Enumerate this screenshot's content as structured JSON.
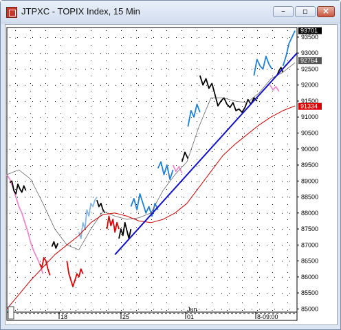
{
  "window": {
    "title": "JTPXC - TOPIX Index, 15 Min",
    "icon": "app-icon",
    "controls": [
      "minimize-icon",
      "maximize-icon",
      "close-icon"
    ]
  },
  "chart_data": {
    "type": "line",
    "title": "JTPXC - TOPIX Index, 15 Min",
    "ylim": [
      84900,
      93800
    ],
    "y_ticks": [
      85000,
      85500,
      86000,
      86500,
      87000,
      87500,
      88000,
      88500,
      89000,
      89500,
      90000,
      90500,
      91000,
      91500,
      92000,
      92500,
      93000,
      93500
    ],
    "y_tick_labels": [
      "85000",
      "85500",
      "86000",
      "86500",
      "87000",
      "87500",
      "88000",
      "88500",
      "89000",
      "89500",
      "90000",
      "90500",
      "91000",
      "91500",
      "92000",
      "92500",
      "93000",
      "93500"
    ],
    "x_tick_labels": [
      "18",
      "25",
      "01",
      "8-09:00"
    ],
    "x_upper_label": "Jun",
    "grid": true,
    "price_tags": [
      {
        "label": "93701",
        "value": 93701,
        "bg": "#000000",
        "fg": "#ffffff"
      },
      {
        "label": "92764",
        "value": 92764,
        "bg": "#555555",
        "fg": "#ffffff"
      },
      {
        "label": "91334",
        "value": 91334,
        "bg": "#dd0000",
        "fg": "#ffffff"
      }
    ],
    "colors": {
      "price_black": "#000000",
      "price_blue": "#1e7fd6",
      "price_lightblue": "#8ab6e0",
      "price_red": "#dd0000",
      "price_pink": "#ee88cc",
      "ma_short": "#666666",
      "ma_long": "#cc0000",
      "trendline": "#1010cc"
    },
    "series": [
      {
        "color_key": "price_pink",
        "points": [
          [
            0,
            89200
          ],
          [
            3,
            89050
          ],
          [
            6,
            88800
          ],
          [
            9,
            88500
          ],
          [
            12,
            88200
          ],
          [
            15,
            88000
          ],
          [
            18,
            87700
          ],
          [
            21,
            87400
          ],
          [
            24,
            87050
          ],
          [
            27,
            86800
          ],
          [
            30,
            86600
          ],
          [
            33,
            86400
          ],
          [
            36,
            86100
          ]
        ]
      },
      {
        "color_key": "price_black",
        "points": [
          [
            3,
            88950
          ],
          [
            5,
            89000
          ],
          [
            7,
            88700
          ],
          [
            9,
            88600
          ],
          [
            11,
            88900
          ],
          [
            13,
            88750
          ],
          [
            15,
            88650
          ],
          [
            17,
            88850
          ],
          [
            19,
            88700
          ]
        ]
      },
      {
        "color_key": "price_red",
        "points": [
          [
            33,
            86400
          ],
          [
            35,
            86300
          ],
          [
            37,
            86600
          ],
          [
            39,
            86500
          ],
          [
            41,
            86250
          ],
          [
            43,
            86050
          ]
        ]
      },
      {
        "color_key": "price_black",
        "points": [
          [
            45,
            86950
          ],
          [
            47,
            87100
          ],
          [
            49,
            86900
          ],
          [
            51,
            87050
          ]
        ]
      },
      {
        "color_key": "price_red",
        "points": [
          [
            60,
            86500
          ],
          [
            62,
            86100
          ],
          [
            64,
            85900
          ],
          [
            66,
            85700
          ],
          [
            68,
            85900
          ],
          [
            70,
            86100
          ],
          [
            72,
            86000
          ],
          [
            74,
            86250
          ],
          [
            76,
            86100
          ]
        ]
      },
      {
        "color_key": "price_lightblue",
        "points": [
          [
            72,
            87400
          ],
          [
            74,
            87200
          ],
          [
            76,
            87700
          ],
          [
            78,
            87500
          ],
          [
            80,
            88100
          ],
          [
            82,
            87900
          ],
          [
            84,
            88300
          ],
          [
            86,
            88200
          ],
          [
            88,
            88400
          ],
          [
            90,
            88500
          ]
        ]
      },
      {
        "color_key": "price_black",
        "points": [
          [
            90,
            88400
          ],
          [
            92,
            88200
          ],
          [
            94,
            88300
          ],
          [
            96,
            88100
          ],
          [
            98,
            88000
          ]
        ]
      },
      {
        "color_key": "price_red",
        "points": [
          [
            100,
            87500
          ],
          [
            102,
            87900
          ],
          [
            104,
            87600
          ],
          [
            106,
            87800
          ],
          [
            108,
            87400
          ],
          [
            110,
            87700
          ],
          [
            112,
            87500
          ]
        ]
      },
      {
        "color_key": "price_black",
        "points": [
          [
            112,
            87200
          ],
          [
            114,
            87500
          ],
          [
            116,
            87300
          ],
          [
            118,
            87700
          ],
          [
            120,
            87450
          ],
          [
            122,
            87200
          ],
          [
            124,
            87500
          ]
        ]
      },
      {
        "color_key": "price_blue",
        "points": [
          [
            124,
            88200
          ],
          [
            127,
            88450
          ],
          [
            130,
            88100
          ],
          [
            133,
            88600
          ],
          [
            136,
            88300
          ],
          [
            139,
            88000
          ],
          [
            142,
            88200
          ],
          [
            145,
            87900
          ],
          [
            148,
            88300
          ],
          [
            151,
            88100
          ]
        ]
      },
      {
        "color_key": "price_blue",
        "points": [
          [
            151,
            89400
          ],
          [
            154,
            89600
          ],
          [
            157,
            89200
          ],
          [
            160,
            89500
          ],
          [
            163,
            89050
          ],
          [
            166,
            89350
          ]
        ]
      },
      {
        "color_key": "price_pink",
        "points": [
          [
            166,
            89500
          ],
          [
            169,
            89300
          ],
          [
            172,
            89450
          ],
          [
            175,
            89250
          ]
        ]
      },
      {
        "color_key": "price_black",
        "points": [
          [
            175,
            89600
          ],
          [
            178,
            89900
          ],
          [
            181,
            89700
          ]
        ]
      },
      {
        "color_key": "price_blue",
        "points": [
          [
            181,
            90700
          ],
          [
            184,
            91200
          ],
          [
            187,
            91000
          ],
          [
            190,
            91400
          ],
          [
            193,
            91150
          ]
        ]
      },
      {
        "color_key": "price_black",
        "points": [
          [
            193,
            92300
          ],
          [
            196,
            92000
          ],
          [
            199,
            92200
          ],
          [
            202,
            91900
          ],
          [
            205,
            92050
          ],
          [
            208,
            91700
          ],
          [
            211,
            91350
          ],
          [
            214,
            91500
          ],
          [
            217,
            91600
          ],
          [
            220,
            91400
          ],
          [
            223,
            91300
          ],
          [
            226,
            91450
          ],
          [
            229,
            91200
          ],
          [
            232,
            91250
          ],
          [
            235,
            91150
          ],
          [
            238,
            91300
          ],
          [
            241,
            91550
          ],
          [
            244,
            91400
          ],
          [
            247,
            91600
          ],
          [
            250,
            91500
          ]
        ]
      },
      {
        "color_key": "price_blue",
        "points": [
          [
            247,
            92300
          ],
          [
            250,
            92800
          ],
          [
            253,
            92600
          ],
          [
            256,
            92500
          ],
          [
            259,
            92900
          ],
          [
            262,
            92650
          ],
          [
            265,
            92500
          ]
        ]
      },
      {
        "color_key": "price_pink",
        "points": [
          [
            263,
            92000
          ],
          [
            266,
            91850
          ],
          [
            269,
            91950
          ],
          [
            272,
            91800
          ]
        ]
      },
      {
        "color_key": "price_black",
        "points": [
          [
            270,
            92300
          ],
          [
            272,
            92450
          ],
          [
            274,
            92550
          ],
          [
            276,
            92400
          ]
        ]
      },
      {
        "color_key": "price_blue",
        "points": [
          [
            276,
            92600
          ],
          [
            279,
            92900
          ],
          [
            282,
            93300
          ],
          [
            285,
            93500
          ],
          [
            288,
            93701
          ]
        ]
      },
      {
        "color_key": "ma_short",
        "points": [
          [
            0,
            89200
          ],
          [
            12,
            89350
          ],
          [
            24,
            89050
          ],
          [
            36,
            88300
          ],
          [
            48,
            87500
          ],
          [
            60,
            87000
          ],
          [
            72,
            86850
          ],
          [
            84,
            87500
          ],
          [
            96,
            88050
          ],
          [
            108,
            87900
          ],
          [
            120,
            87800
          ],
          [
            132,
            87850
          ],
          [
            144,
            88000
          ],
          [
            156,
            88700
          ],
          [
            168,
            89200
          ],
          [
            180,
            89600
          ],
          [
            192,
            90700
          ],
          [
            204,
            91600
          ],
          [
            216,
            91600
          ],
          [
            228,
            91500
          ],
          [
            240,
            91450
          ],
          [
            252,
            91750
          ],
          [
            264,
            92200
          ],
          [
            276,
            92400
          ],
          [
            288,
            92700
          ]
        ]
      },
      {
        "color_key": "ma_long",
        "points": [
          [
            0,
            85000
          ],
          [
            12,
            85450
          ],
          [
            24,
            85900
          ],
          [
            36,
            86300
          ],
          [
            48,
            86700
          ],
          [
            60,
            87000
          ],
          [
            72,
            87300
          ],
          [
            84,
            87700
          ],
          [
            96,
            87950
          ],
          [
            108,
            88000
          ],
          [
            120,
            87900
          ],
          [
            132,
            87750
          ],
          [
            144,
            87700
          ],
          [
            156,
            87800
          ],
          [
            168,
            88000
          ],
          [
            180,
            88300
          ],
          [
            192,
            88800
          ],
          [
            204,
            89300
          ],
          [
            216,
            89800
          ],
          [
            228,
            90150
          ],
          [
            240,
            90450
          ],
          [
            252,
            90750
          ],
          [
            264,
            91000
          ],
          [
            276,
            91200
          ],
          [
            288,
            91350
          ]
        ]
      },
      {
        "color_key": "trendline",
        "points": [
          [
            108,
            86700
          ],
          [
            290,
            93000
          ]
        ]
      }
    ]
  }
}
